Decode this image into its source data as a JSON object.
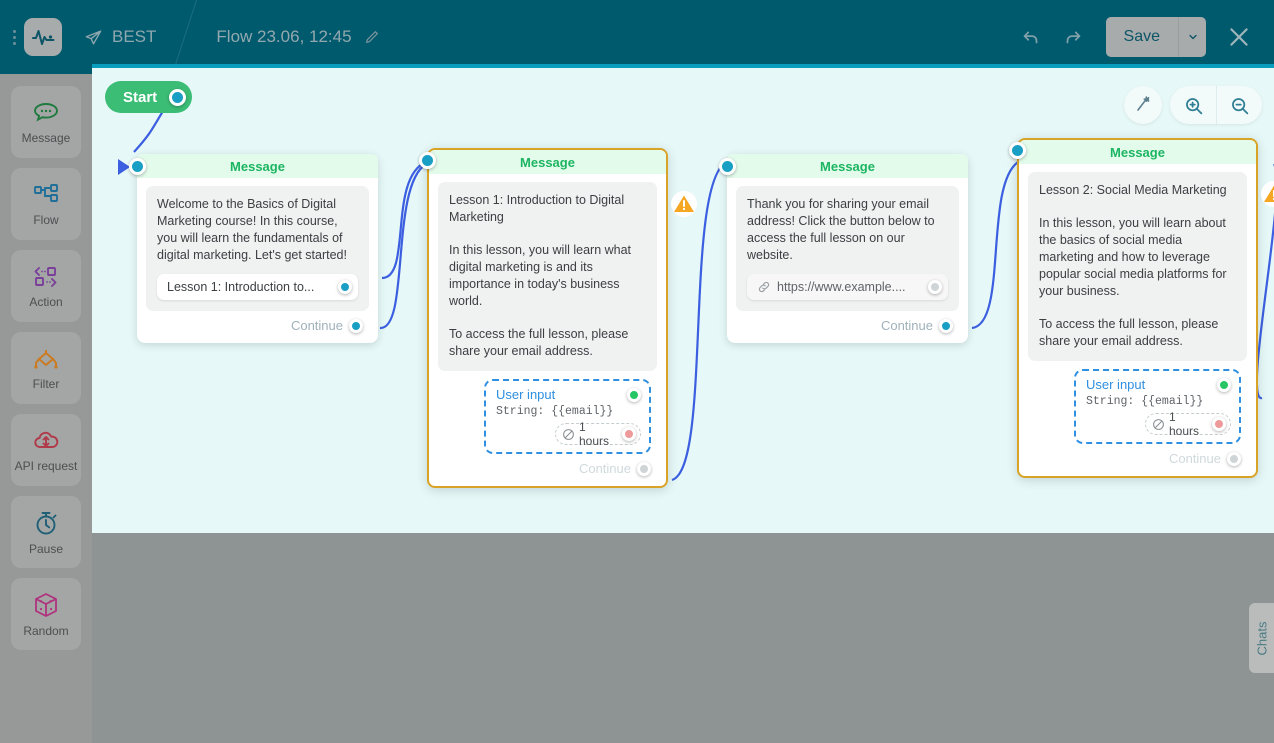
{
  "topbar": {
    "logo_icon": "pulse-logo-icon",
    "brand_icon": "telegram-plane-icon",
    "brand_name": "BEST",
    "flow_title": "Flow 23.06, 12:45",
    "edit_icon": "pencil-icon",
    "undo_icon": "undo-arrow-icon",
    "redo_icon": "redo-arrow-icon",
    "save_label": "Save",
    "save_caret_icon": "chevron-down-icon",
    "close_icon": "close-x-icon"
  },
  "sidebar": {
    "items": [
      {
        "label": "Message",
        "icon": "chat-bubble-icon",
        "color": "#1f7a3f"
      },
      {
        "label": "Flow",
        "icon": "flow-tree-icon",
        "color": "#1f6f99"
      },
      {
        "label": "Action",
        "icon": "action-code-icon",
        "color": "#7a3f99"
      },
      {
        "label": "Filter",
        "icon": "filter-diamond-icon",
        "color": "#cc7a1f"
      },
      {
        "label": "API request",
        "icon": "api-cloud-icon",
        "color": "#b03a4a"
      },
      {
        "label": "Pause",
        "icon": "stopwatch-icon",
        "color": "#1f5f77"
      },
      {
        "label": "Random",
        "icon": "dice-cube-icon",
        "color": "#b0327f"
      }
    ]
  },
  "canvas": {
    "background_color": "#e6f8f7",
    "edge_color": "#3b5fe0",
    "tools": [
      {
        "name": "magic-wand-icon",
        "label": "Auto layout"
      },
      {
        "name": "zoom-in-icon",
        "label": "Zoom in"
      },
      {
        "name": "zoom-out-icon",
        "label": "Zoom out"
      }
    ],
    "start": {
      "label": "Start"
    },
    "chats_tab_label": "Chats"
  },
  "nodes": [
    {
      "id": "node1",
      "title": "Message",
      "selected": false,
      "warning": false,
      "paragraphs": [
        "Welcome to the Basics of Digital Marketing course! In this course, you will learn the fundamentals of digital marketing. Let's get started!"
      ],
      "button": {
        "label": "Lesson 1: Introduction to...",
        "type": "reply"
      },
      "continue_label": "Continue",
      "continue_dim": false,
      "user_input": null
    },
    {
      "id": "node2",
      "title": "Message",
      "selected": true,
      "warning": true,
      "paragraphs": [
        "Lesson 1: Introduction to Digital Marketing",
        "In this lesson, you will learn what digital marketing is and its importance in today's business world.",
        "To access the full lesson, please share your email address."
      ],
      "button": null,
      "continue_label": "Continue",
      "continue_dim": true,
      "user_input": {
        "title": "User input",
        "string": "String: {{email}}",
        "timeout": "1 hours",
        "timeout_icon": "no-entry-icon"
      }
    },
    {
      "id": "node3",
      "title": "Message",
      "selected": false,
      "warning": false,
      "paragraphs": [
        "Thank you for sharing your email address! Click the button below to access the full lesson on our website."
      ],
      "button": {
        "label": "https://www.example....",
        "type": "url",
        "icon": "link-icon"
      },
      "continue_label": "Continue",
      "continue_dim": false,
      "user_input": null
    },
    {
      "id": "node4",
      "title": "Message",
      "selected": true,
      "warning": true,
      "paragraphs": [
        "Lesson 2: Social Media Marketing",
        "In this lesson, you will learn about the basics of social media marketing and how to leverage popular social media platforms for your business.",
        "To access the full lesson, please share your email address."
      ],
      "button": null,
      "continue_label": "Continue",
      "continue_dim": true,
      "user_input": {
        "title": "User input",
        "string": "String: {{email}}",
        "timeout": "1 hours",
        "timeout_icon": "no-entry-icon"
      }
    }
  ]
}
